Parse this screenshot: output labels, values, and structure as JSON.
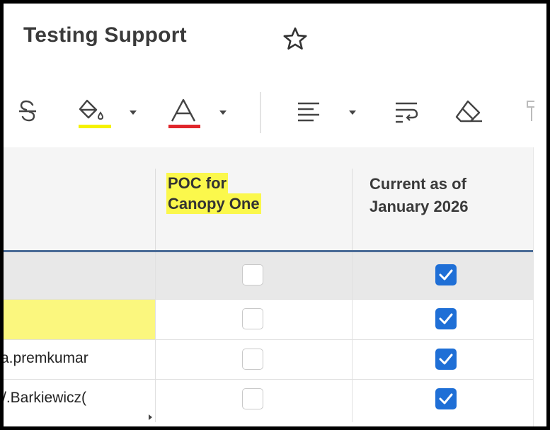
{
  "sheet": {
    "title": "Testing Support"
  },
  "toolbar": {
    "icons": [
      "strikethrough-icon",
      "fill-color-icon",
      "text-color-icon",
      "align-left-icon",
      "wrap-text-icon",
      "eraser-icon"
    ],
    "fill_color": "#f5f200",
    "text_color": "#e0262b"
  },
  "columns": [
    {
      "label": ""
    },
    {
      "label_line1": "POC for",
      "label_line2": "Canopy One",
      "highlight": "#fbf84c"
    },
    {
      "label_line1": "Current as of",
      "label_line2": "January 2026"
    }
  ],
  "rows": [
    {
      "col_a": "",
      "poc": false,
      "current": true,
      "selected": true
    },
    {
      "col_a": "",
      "poc": false,
      "current": true,
      "highlight": "#fbf77e"
    },
    {
      "col_a": "a.premkumar",
      "poc": false,
      "current": true
    },
    {
      "col_a": "/.Barkiewicz(",
      "poc": false,
      "current": true
    }
  ],
  "colors": {
    "accent": "#1f6fd6",
    "header_rule": "#4a6b96"
  }
}
